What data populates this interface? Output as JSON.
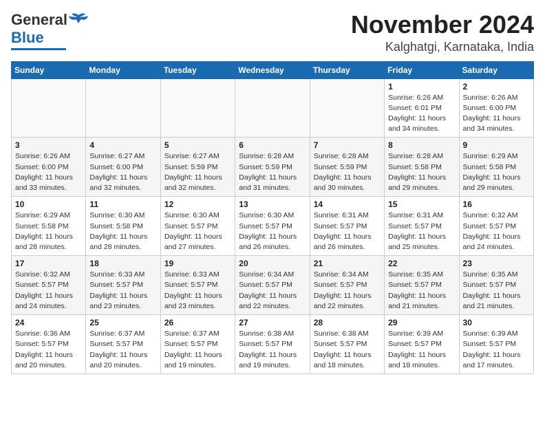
{
  "logo": {
    "general": "General",
    "blue": "Blue"
  },
  "header": {
    "month": "November 2024",
    "location": "Kalghatgi, Karnataka, India"
  },
  "weekdays": [
    "Sunday",
    "Monday",
    "Tuesday",
    "Wednesday",
    "Thursday",
    "Friday",
    "Saturday"
  ],
  "weeks": [
    [
      {
        "day": "",
        "info": ""
      },
      {
        "day": "",
        "info": ""
      },
      {
        "day": "",
        "info": ""
      },
      {
        "day": "",
        "info": ""
      },
      {
        "day": "",
        "info": ""
      },
      {
        "day": "1",
        "info": "Sunrise: 6:26 AM\nSunset: 6:01 PM\nDaylight: 11 hours\nand 34 minutes."
      },
      {
        "day": "2",
        "info": "Sunrise: 6:26 AM\nSunset: 6:00 PM\nDaylight: 11 hours\nand 34 minutes."
      }
    ],
    [
      {
        "day": "3",
        "info": "Sunrise: 6:26 AM\nSunset: 6:00 PM\nDaylight: 11 hours\nand 33 minutes."
      },
      {
        "day": "4",
        "info": "Sunrise: 6:27 AM\nSunset: 6:00 PM\nDaylight: 11 hours\nand 32 minutes."
      },
      {
        "day": "5",
        "info": "Sunrise: 6:27 AM\nSunset: 5:59 PM\nDaylight: 11 hours\nand 32 minutes."
      },
      {
        "day": "6",
        "info": "Sunrise: 6:28 AM\nSunset: 5:59 PM\nDaylight: 11 hours\nand 31 minutes."
      },
      {
        "day": "7",
        "info": "Sunrise: 6:28 AM\nSunset: 5:59 PM\nDaylight: 11 hours\nand 30 minutes."
      },
      {
        "day": "8",
        "info": "Sunrise: 6:28 AM\nSunset: 5:58 PM\nDaylight: 11 hours\nand 29 minutes."
      },
      {
        "day": "9",
        "info": "Sunrise: 6:29 AM\nSunset: 5:58 PM\nDaylight: 11 hours\nand 29 minutes."
      }
    ],
    [
      {
        "day": "10",
        "info": "Sunrise: 6:29 AM\nSunset: 5:58 PM\nDaylight: 11 hours\nand 28 minutes."
      },
      {
        "day": "11",
        "info": "Sunrise: 6:30 AM\nSunset: 5:58 PM\nDaylight: 11 hours\nand 28 minutes."
      },
      {
        "day": "12",
        "info": "Sunrise: 6:30 AM\nSunset: 5:57 PM\nDaylight: 11 hours\nand 27 minutes."
      },
      {
        "day": "13",
        "info": "Sunrise: 6:30 AM\nSunset: 5:57 PM\nDaylight: 11 hours\nand 26 minutes."
      },
      {
        "day": "14",
        "info": "Sunrise: 6:31 AM\nSunset: 5:57 PM\nDaylight: 11 hours\nand 26 minutes."
      },
      {
        "day": "15",
        "info": "Sunrise: 6:31 AM\nSunset: 5:57 PM\nDaylight: 11 hours\nand 25 minutes."
      },
      {
        "day": "16",
        "info": "Sunrise: 6:32 AM\nSunset: 5:57 PM\nDaylight: 11 hours\nand 24 minutes."
      }
    ],
    [
      {
        "day": "17",
        "info": "Sunrise: 6:32 AM\nSunset: 5:57 PM\nDaylight: 11 hours\nand 24 minutes."
      },
      {
        "day": "18",
        "info": "Sunrise: 6:33 AM\nSunset: 5:57 PM\nDaylight: 11 hours\nand 23 minutes."
      },
      {
        "day": "19",
        "info": "Sunrise: 6:33 AM\nSunset: 5:57 PM\nDaylight: 11 hours\nand 23 minutes."
      },
      {
        "day": "20",
        "info": "Sunrise: 6:34 AM\nSunset: 5:57 PM\nDaylight: 11 hours\nand 22 minutes."
      },
      {
        "day": "21",
        "info": "Sunrise: 6:34 AM\nSunset: 5:57 PM\nDaylight: 11 hours\nand 22 minutes."
      },
      {
        "day": "22",
        "info": "Sunrise: 6:35 AM\nSunset: 5:57 PM\nDaylight: 11 hours\nand 21 minutes."
      },
      {
        "day": "23",
        "info": "Sunrise: 6:35 AM\nSunset: 5:57 PM\nDaylight: 11 hours\nand 21 minutes."
      }
    ],
    [
      {
        "day": "24",
        "info": "Sunrise: 6:36 AM\nSunset: 5:57 PM\nDaylight: 11 hours\nand 20 minutes."
      },
      {
        "day": "25",
        "info": "Sunrise: 6:37 AM\nSunset: 5:57 PM\nDaylight: 11 hours\nand 20 minutes."
      },
      {
        "day": "26",
        "info": "Sunrise: 6:37 AM\nSunset: 5:57 PM\nDaylight: 11 hours\nand 19 minutes."
      },
      {
        "day": "27",
        "info": "Sunrise: 6:38 AM\nSunset: 5:57 PM\nDaylight: 11 hours\nand 19 minutes."
      },
      {
        "day": "28",
        "info": "Sunrise: 6:38 AM\nSunset: 5:57 PM\nDaylight: 11 hours\nand 18 minutes."
      },
      {
        "day": "29",
        "info": "Sunrise: 6:39 AM\nSunset: 5:57 PM\nDaylight: 11 hours\nand 18 minutes."
      },
      {
        "day": "30",
        "info": "Sunrise: 6:39 AM\nSunset: 5:57 PM\nDaylight: 11 hours\nand 17 minutes."
      }
    ]
  ]
}
